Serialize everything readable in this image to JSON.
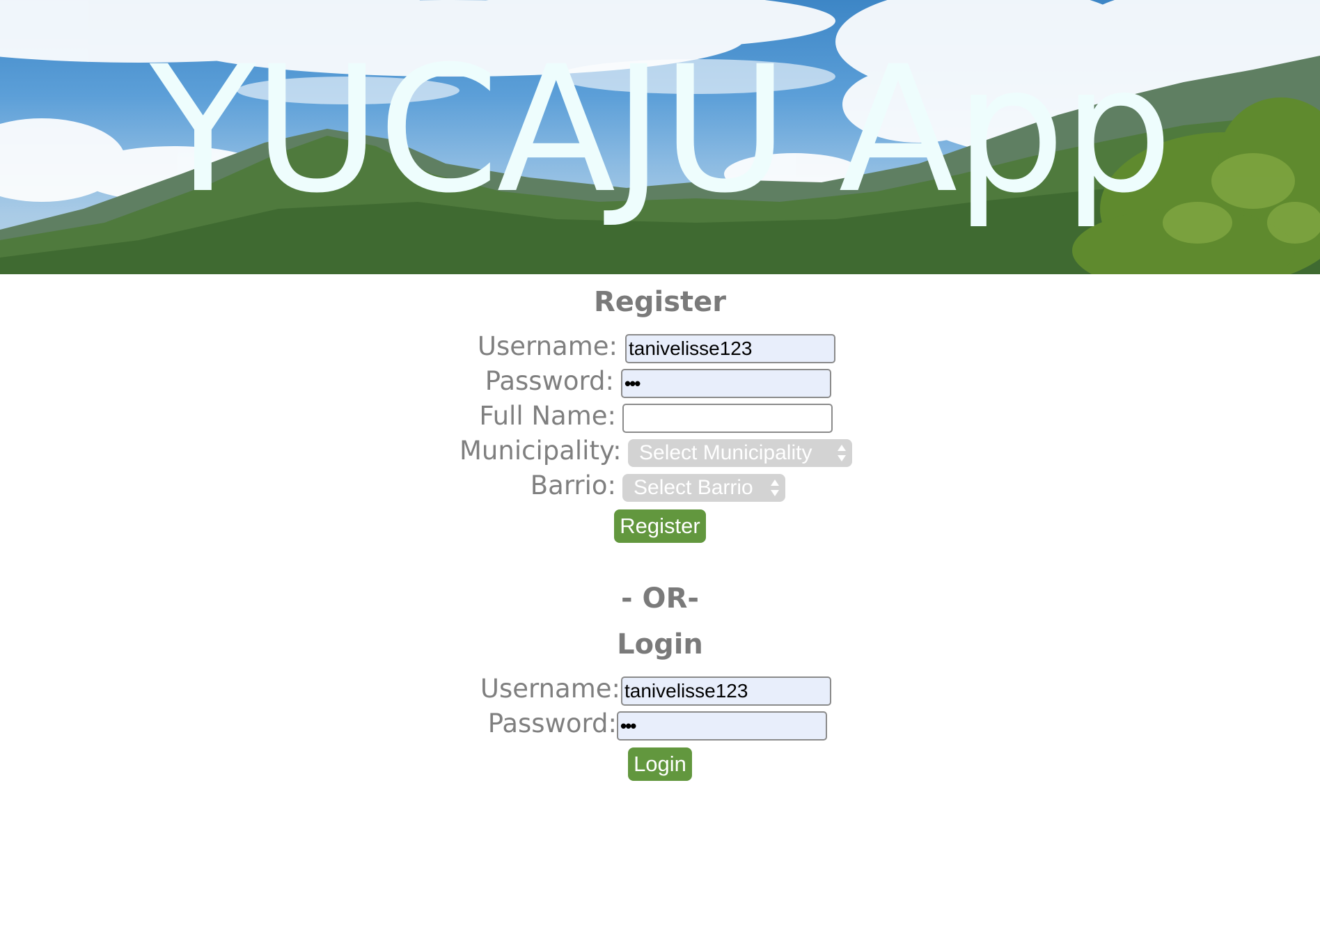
{
  "header": {
    "title": "YUCAJU App"
  },
  "register": {
    "heading": "Register",
    "username_label": "Username:",
    "username_value": "tanivelisse123",
    "password_label": "Password:",
    "password_value": "•••",
    "fullname_label": "Full Name:",
    "fullname_value": "",
    "municipality_label": "Municipality:",
    "municipality_selected": "Select Municipality",
    "barrio_label": "Barrio:",
    "barrio_selected": "Select Barrio",
    "button_label": "Register"
  },
  "separator": "- OR-",
  "login": {
    "heading": "Login",
    "username_label": "Username:",
    "username_value": "tanivelisse123",
    "password_label": "Password:",
    "password_value": "•••",
    "button_label": "Login"
  },
  "colors": {
    "button_bg": "#62973e",
    "label_text": "#7f7f7f",
    "autofill_bg": "#e8eefb",
    "select_bg": "#d3d3d3",
    "title_text": "#eefdfd"
  }
}
